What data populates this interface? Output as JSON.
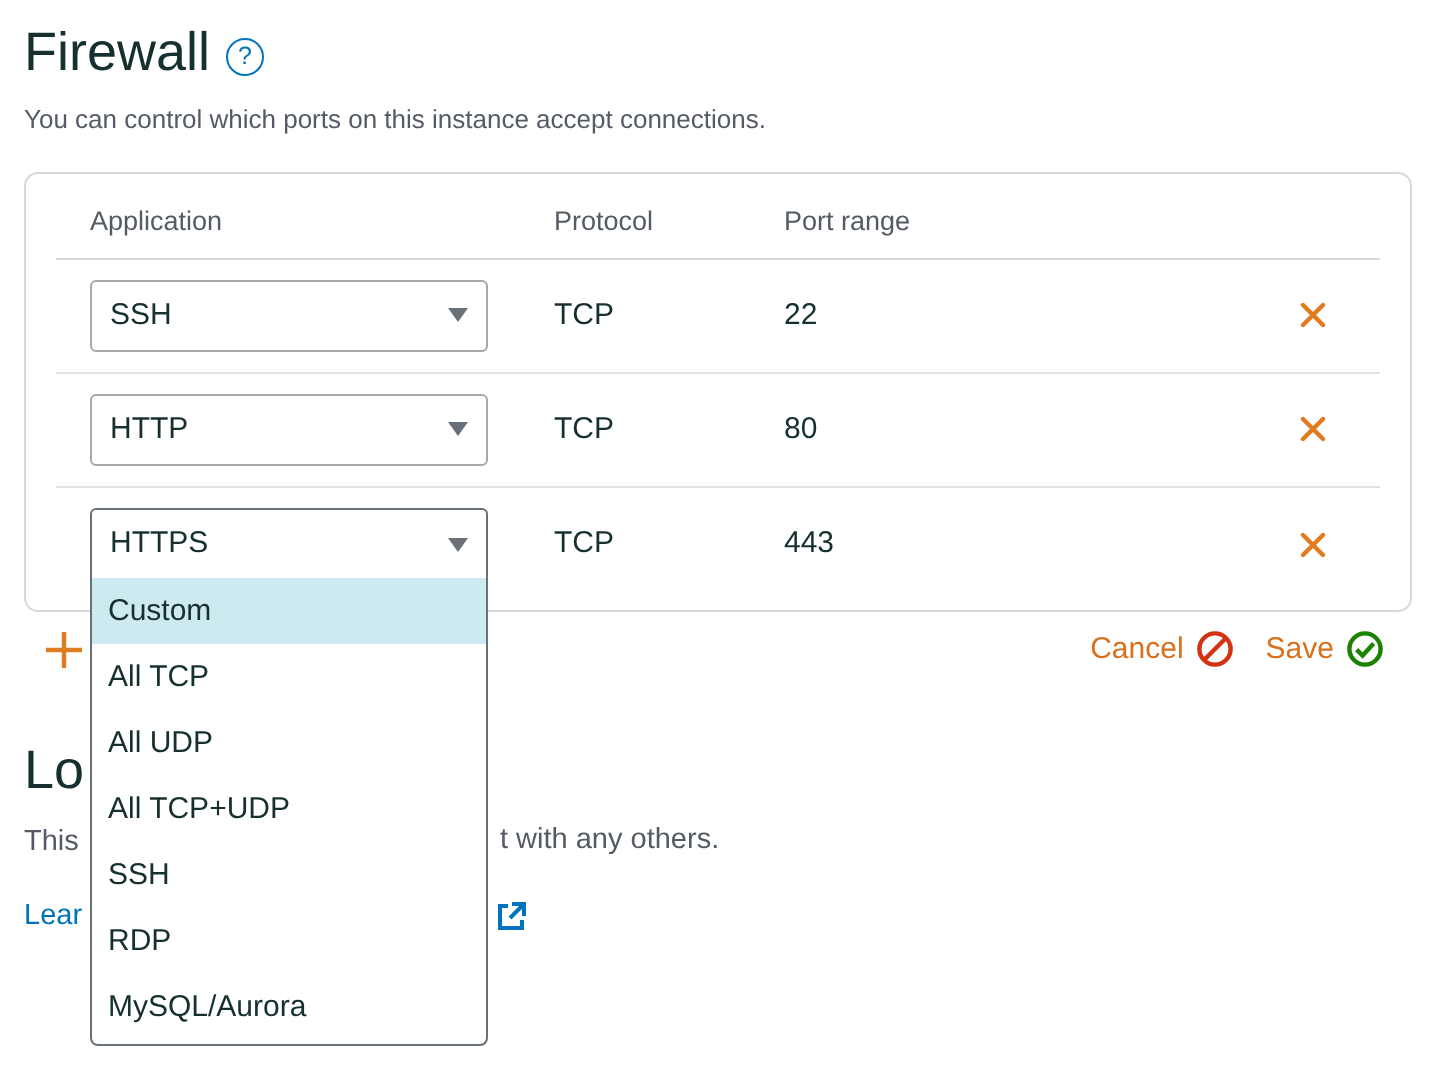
{
  "title": "Firewall",
  "help": "?",
  "subtitle": "You can control which ports on this instance accept connections.",
  "columns": [
    "Application",
    "Protocol",
    "Port range"
  ],
  "rules": [
    {
      "application": "SSH",
      "protocol": "TCP",
      "port_range": "22",
      "open": false
    },
    {
      "application": "HTTP",
      "protocol": "TCP",
      "port_range": "80",
      "open": false
    },
    {
      "application": "HTTPS",
      "protocol": "TCP",
      "port_range": "443",
      "open": true
    }
  ],
  "dropdown_options": [
    {
      "label": "Custom",
      "selected": true
    },
    {
      "label": "All TCP",
      "selected": false
    },
    {
      "label": "All UDP",
      "selected": false
    },
    {
      "label": "All TCP+UDP",
      "selected": false
    },
    {
      "label": "SSH",
      "selected": false
    },
    {
      "label": "RDP",
      "selected": false
    },
    {
      "label": "MySQL/Aurora",
      "selected": false
    }
  ],
  "actions": {
    "cancel": "Cancel",
    "save": "Save"
  },
  "next_section": {
    "title": "Lo",
    "text_left": "This",
    "text_right": "t with any others.",
    "link": "Lear"
  }
}
